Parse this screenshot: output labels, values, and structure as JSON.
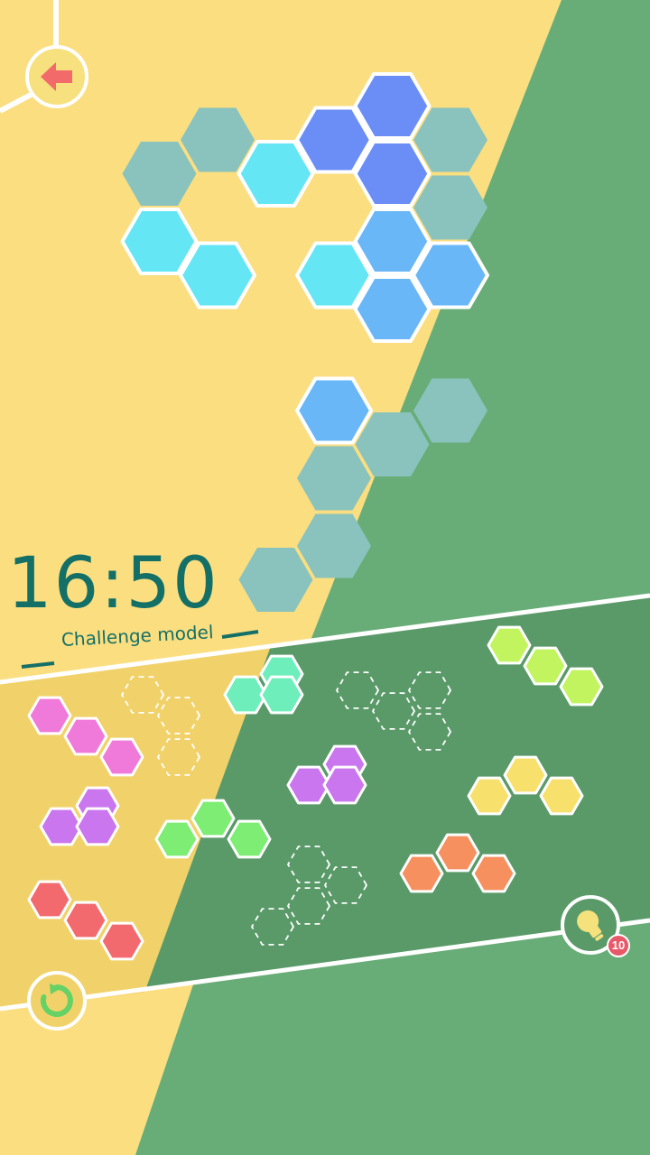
{
  "timer": {
    "time": "16:50",
    "mode_label": "Challenge model"
  },
  "hint": {
    "count": "10"
  },
  "icons": {
    "back": "arrow-left-icon",
    "undo": "restart-icon",
    "hint": "lightbulb-icon"
  },
  "colors": {
    "background_yellow": "#fbde80",
    "background_green": "#68ad77",
    "tray_yellow": "#f1d26a",
    "tray_green": "#5a9a69",
    "empty_cell": "#8ac3bd",
    "text": "#147066",
    "badge": "#e85869",
    "back_arrow": "#f26a6a",
    "undo_icon": "#66d266"
  },
  "board": {
    "empty_cells": [
      [
        -1,
        -4
      ],
      [
        0,
        -5
      ],
      [
        4,
        -5
      ],
      [
        4,
        -4
      ],
      [
        2,
        0
      ],
      [
        4,
        -1
      ],
      [
        3,
        0
      ],
      [
        2,
        1
      ],
      [
        1,
        2
      ]
    ],
    "placed_pieces": [
      {
        "color": "#6b8ef6",
        "cells": [
          [
            2,
            -5
          ],
          [
            3,
            -5
          ],
          [
            3,
            -4
          ]
        ]
      },
      {
        "color": "#65e6f5",
        "cells": [
          [
            -1,
            -3
          ],
          [
            0,
            -3
          ],
          [
            1,
            -4
          ],
          [
            2,
            -3
          ]
        ]
      },
      {
        "color": "#6ab7f7",
        "cells": [
          [
            3,
            -3
          ],
          [
            4,
            -3
          ],
          [
            3,
            -2
          ],
          [
            2,
            -1
          ]
        ]
      }
    ]
  },
  "tray": {
    "pieces": [
      {
        "color": "#f07ad9",
        "cells": [
          [
            -1.0,
            0.0
          ],
          [
            0.0,
            0.0
          ],
          [
            1.0,
            0.0
          ]
        ]
      },
      {
        "color": "#ca76ee",
        "cells": [
          [
            0.0,
            0.0
          ],
          [
            1.0,
            -1.0
          ],
          [
            1.0,
            0.0
          ]
        ]
      },
      {
        "color": "#f26a6e",
        "cells": [
          [
            -1.0,
            0.0
          ],
          [
            0.0,
            0.0
          ],
          [
            1.0,
            0.0
          ]
        ]
      },
      {
        "color": "#6deebb",
        "cells": [
          [
            0.0,
            0.0
          ],
          [
            1.0,
            -1.0
          ],
          [
            1.0,
            0.0
          ]
        ]
      },
      {
        "color": "#7ded74",
        "cells": [
          [
            0.0,
            0.0
          ],
          [
            1.0,
            -1.0
          ],
          [
            2.0,
            0.0
          ]
        ]
      },
      {
        "color": "#ca76ee",
        "cells": [
          [
            0.0,
            0.0
          ],
          [
            1.0,
            -1.0
          ],
          [
            1.0,
            0.0
          ]
        ]
      },
      {
        "color": "#c2f460",
        "cells": [
          [
            -1.0,
            0.0
          ],
          [
            0.0,
            0.0
          ],
          [
            1.0,
            0.0
          ]
        ]
      },
      {
        "color": "#f8e06c",
        "cells": [
          [
            0.0,
            0.0
          ],
          [
            1.0,
            -1.0
          ],
          [
            2.0,
            0.0
          ]
        ]
      },
      {
        "color": "#f6905f",
        "cells": [
          [
            0.0,
            0.0
          ],
          [
            1.0,
            -1.0
          ],
          [
            2.0,
            0.0
          ]
        ]
      }
    ],
    "empty_slots": 3
  }
}
